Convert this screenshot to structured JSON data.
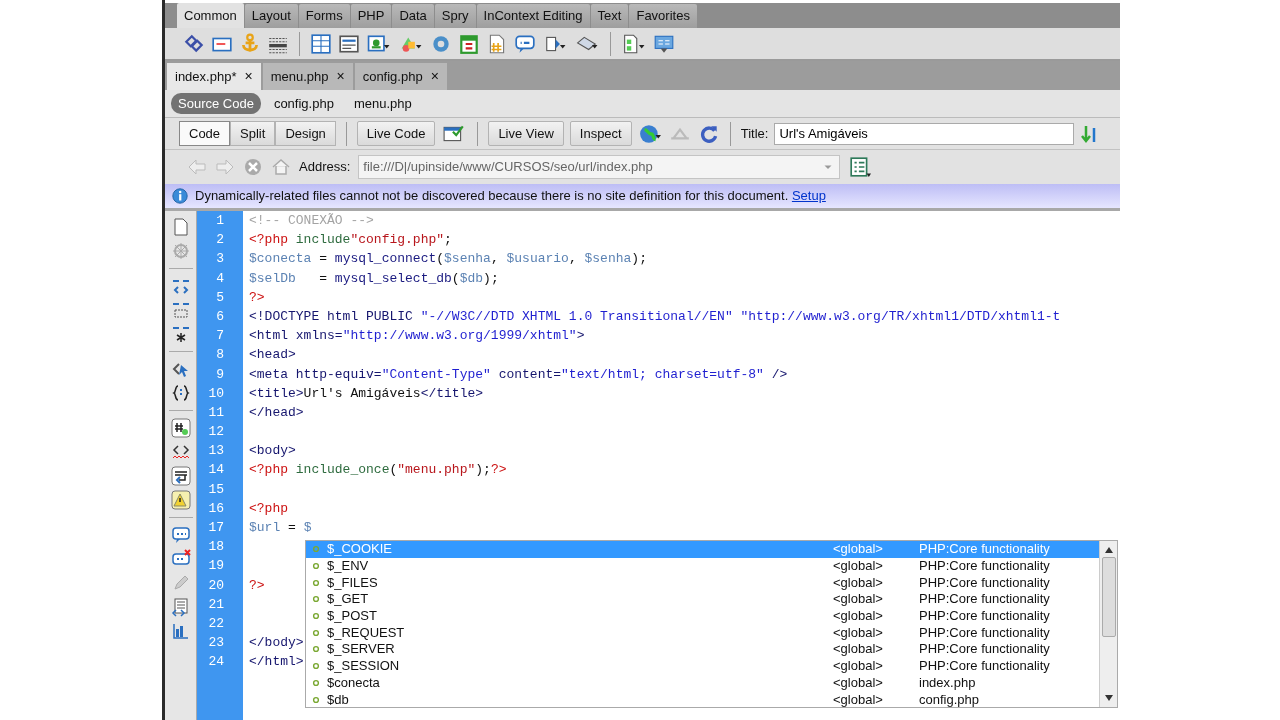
{
  "insert_panel": {
    "tabs": [
      {
        "label": "Common",
        "selected": true
      },
      {
        "label": "Layout",
        "selected": false
      },
      {
        "label": "Forms",
        "selected": false
      },
      {
        "label": "PHP",
        "selected": false
      },
      {
        "label": "Data",
        "selected": false
      },
      {
        "label": "Spry",
        "selected": false
      },
      {
        "label": "InContext Editing",
        "selected": false
      },
      {
        "label": "Text",
        "selected": false
      },
      {
        "label": "Favorites",
        "selected": false
      }
    ]
  },
  "document_tabs": [
    {
      "label": "index.php*",
      "close": "×",
      "selected": true
    },
    {
      "label": "menu.php",
      "close": "×",
      "selected": false
    },
    {
      "label": "config.php",
      "close": "×",
      "selected": false
    }
  ],
  "related_files": [
    {
      "label": "Source Code",
      "selected": true
    },
    {
      "label": "config.php",
      "selected": false
    },
    {
      "label": "menu.php",
      "selected": false
    }
  ],
  "document_toolbar": {
    "view_buttons": [
      {
        "label": "Code",
        "selected": true
      },
      {
        "label": "Split",
        "selected": false
      },
      {
        "label": "Design",
        "selected": false
      }
    ],
    "live_code": "Live Code",
    "live_view": "Live View",
    "inspect": "Inspect",
    "title_label": "Title:",
    "title_value": "Url's Amigáveis"
  },
  "address_bar": {
    "label": "Address:",
    "value": "file:///D|/upinside/www/CURSOS/seo/url/index.php"
  },
  "info_bar": {
    "message": "Dynamically-related files cannot not be discovered because there is no site definition for this document.",
    "link": "Setup"
  },
  "editor": {
    "lines": [
      {
        "number": "1",
        "tokens": [
          {
            "kind": "comment",
            "text": "<!-- CONEXÃO -->"
          }
        ]
      },
      {
        "number": "2",
        "tokens": [
          {
            "kind": "php_tag",
            "text": "<?php"
          },
          {
            "kind": "keyword",
            "text": " include"
          },
          {
            "kind": "string",
            "text": "\"config.php\""
          },
          {
            "kind": "punct",
            "text": ";"
          }
        ]
      },
      {
        "number": "3",
        "tokens": [
          {
            "kind": "variable",
            "text": "$conecta"
          },
          {
            "kind": "punct",
            "text": " = "
          },
          {
            "kind": "function",
            "text": "mysql_connect"
          },
          {
            "kind": "punct",
            "text": "("
          },
          {
            "kind": "variable",
            "text": "$senha"
          },
          {
            "kind": "punct",
            "text": ", "
          },
          {
            "kind": "variable",
            "text": "$usuario"
          },
          {
            "kind": "punct",
            "text": ", "
          },
          {
            "kind": "variable",
            "text": "$senha"
          },
          {
            "kind": "punct",
            "text": ");"
          }
        ]
      },
      {
        "number": "4",
        "tokens": [
          {
            "kind": "variable",
            "text": "$selDb"
          },
          {
            "kind": "punct",
            "text": "   = "
          },
          {
            "kind": "function",
            "text": "mysql_select_db"
          },
          {
            "kind": "punct",
            "text": "("
          },
          {
            "kind": "variable",
            "text": "$db"
          },
          {
            "kind": "punct",
            "text": ");"
          }
        ]
      },
      {
        "number": "5",
        "tokens": [
          {
            "kind": "php_tag",
            "text": "?>"
          }
        ]
      },
      {
        "number": "6",
        "tokens": [
          {
            "kind": "html_tag",
            "text": "<!DOCTYPE html PUBLIC "
          },
          {
            "kind": "attr_value",
            "text": "\"-//W3C//DTD XHTML 1.0 Transitional//EN\" \"http://www.w3.org/TR/xhtml1/DTD/xhtml1-t"
          }
        ]
      },
      {
        "number": "7",
        "tokens": [
          {
            "kind": "html_tag",
            "text": "<html xmlns="
          },
          {
            "kind": "attr_value",
            "text": "\"http://www.w3.org/1999/xhtml\""
          },
          {
            "kind": "html_tag",
            "text": ">"
          }
        ]
      },
      {
        "number": "8",
        "tokens": [
          {
            "kind": "html_tag",
            "text": "<head>"
          }
        ]
      },
      {
        "number": "9",
        "tokens": [
          {
            "kind": "html_tag",
            "text": "<meta http-equiv="
          },
          {
            "kind": "attr_value",
            "text": "\"Content-Type\""
          },
          {
            "kind": "html_tag",
            "text": " content="
          },
          {
            "kind": "attr_value",
            "text": "\"text/html; charset=utf-8\""
          },
          {
            "kind": "html_tag",
            "text": " />"
          }
        ]
      },
      {
        "number": "10",
        "tokens": [
          {
            "kind": "html_tag",
            "text": "<title>"
          },
          {
            "kind": "text",
            "text": "Url's Amigáveis"
          },
          {
            "kind": "html_tag",
            "text": "</title>"
          }
        ]
      },
      {
        "number": "11",
        "tokens": [
          {
            "kind": "html_tag",
            "text": "</head>"
          }
        ]
      },
      {
        "number": "12"
      },
      {
        "number": "13",
        "tokens": [
          {
            "kind": "html_tag",
            "text": "<body>"
          }
        ]
      },
      {
        "number": "14",
        "tokens": [
          {
            "kind": "php_tag",
            "text": "<?php"
          },
          {
            "kind": "keyword",
            "text": " include_once"
          },
          {
            "kind": "punct",
            "text": "("
          },
          {
            "kind": "string",
            "text": "\"menu.php\""
          },
          {
            "kind": "punct",
            "text": ");"
          },
          {
            "kind": "php_tag",
            "text": "?>"
          }
        ]
      },
      {
        "number": "15"
      },
      {
        "number": "16",
        "tokens": [
          {
            "kind": "php_tag",
            "text": "<?php"
          }
        ]
      },
      {
        "number": "17",
        "tokens": [
          {
            "kind": "variable",
            "text": "$url"
          },
          {
            "kind": "punct",
            "text": " = "
          },
          {
            "kind": "variable",
            "text": "$"
          }
        ]
      },
      {
        "number": "18"
      },
      {
        "number": "19"
      },
      {
        "number": "20",
        "tokens": [
          {
            "kind": "php_tag",
            "text": "?>"
          }
        ]
      },
      {
        "number": "21"
      },
      {
        "number": "22"
      },
      {
        "number": "23",
        "tokens": [
          {
            "kind": "html_tag",
            "text": "</body>"
          }
        ]
      },
      {
        "number": "24",
        "tokens": [
          {
            "kind": "html_tag",
            "text": "</html>"
          }
        ]
      }
    ]
  },
  "autocomplete": {
    "items": [
      {
        "name": "$_COOKIE",
        "scope": "<global>",
        "source": "PHP:Core functionality",
        "selected": true
      },
      {
        "name": "$_ENV",
        "scope": "<global>",
        "source": "PHP:Core functionality",
        "selected": false
      },
      {
        "name": "$_FILES",
        "scope": "<global>",
        "source": "PHP:Core functionality",
        "selected": false
      },
      {
        "name": "$_GET",
        "scope": "<global>",
        "source": "PHP:Core functionality",
        "selected": false
      },
      {
        "name": "$_POST",
        "scope": "<global>",
        "source": "PHP:Core functionality",
        "selected": false
      },
      {
        "name": "$_REQUEST",
        "scope": "<global>",
        "source": "PHP:Core functionality",
        "selected": false
      },
      {
        "name": "$_SERVER",
        "scope": "<global>",
        "source": "PHP:Core functionality",
        "selected": false
      },
      {
        "name": "$_SESSION",
        "scope": "<global>",
        "source": "PHP:Core functionality",
        "selected": false
      },
      {
        "name": "$conecta",
        "scope": "<global>",
        "source": "index.php",
        "selected": false
      },
      {
        "name": "$db",
        "scope": "<global>",
        "source": "config.php",
        "selected": false
      }
    ]
  }
}
